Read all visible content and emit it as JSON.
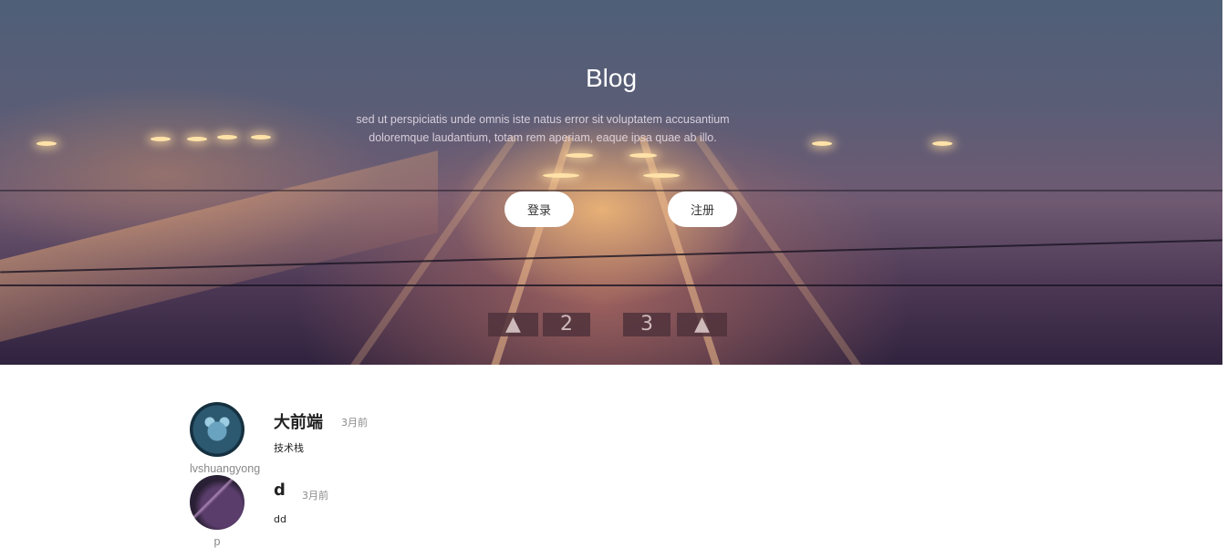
{
  "hero": {
    "title": "Blog",
    "description": "sed ut perspiciatis unde omnis iste natus error sit voluptatem accusantium doloremque laudantium, totam rem aperiam, eaque ipsa quae ab illo.",
    "login_label": "登录",
    "register_label": "注册",
    "sign_left": "2",
    "sign_right": "3"
  },
  "posts": [
    {
      "author": "lvshuangyong",
      "title": "大前端",
      "time": "3月前",
      "content": "技术栈"
    },
    {
      "author": "p",
      "title": "d",
      "time": "3月前",
      "content": "dd"
    }
  ]
}
